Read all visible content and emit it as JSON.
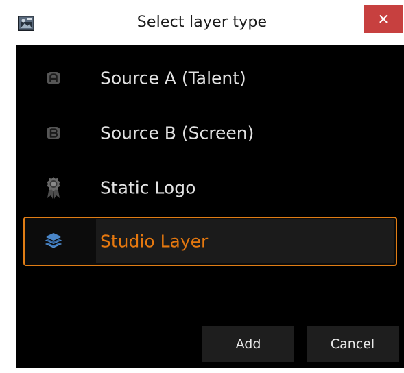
{
  "window": {
    "title": "Select layer type",
    "close_glyph": "✕"
  },
  "icons": {
    "app": "app-window-icon",
    "close": "close-icon",
    "source_a": "source-a-badge-icon",
    "source_b": "source-b-badge-icon",
    "logo": "award-ribbon-icon",
    "studio": "stacked-layers-icon"
  },
  "layers": [
    {
      "label": "Source A (Talent)",
      "selected": false
    },
    {
      "label": "Source B (Screen)",
      "selected": false
    },
    {
      "label": "Static Logo",
      "selected": false
    },
    {
      "label": "Studio Layer",
      "selected": true
    }
  ],
  "buttons": {
    "add": "Add",
    "cancel": "Cancel"
  },
  "colors": {
    "accent": "#e07d15",
    "selected_text": "#e5780f",
    "background": "#000000",
    "close": "#c7403f",
    "studio_icon": "#3f7ec4"
  }
}
